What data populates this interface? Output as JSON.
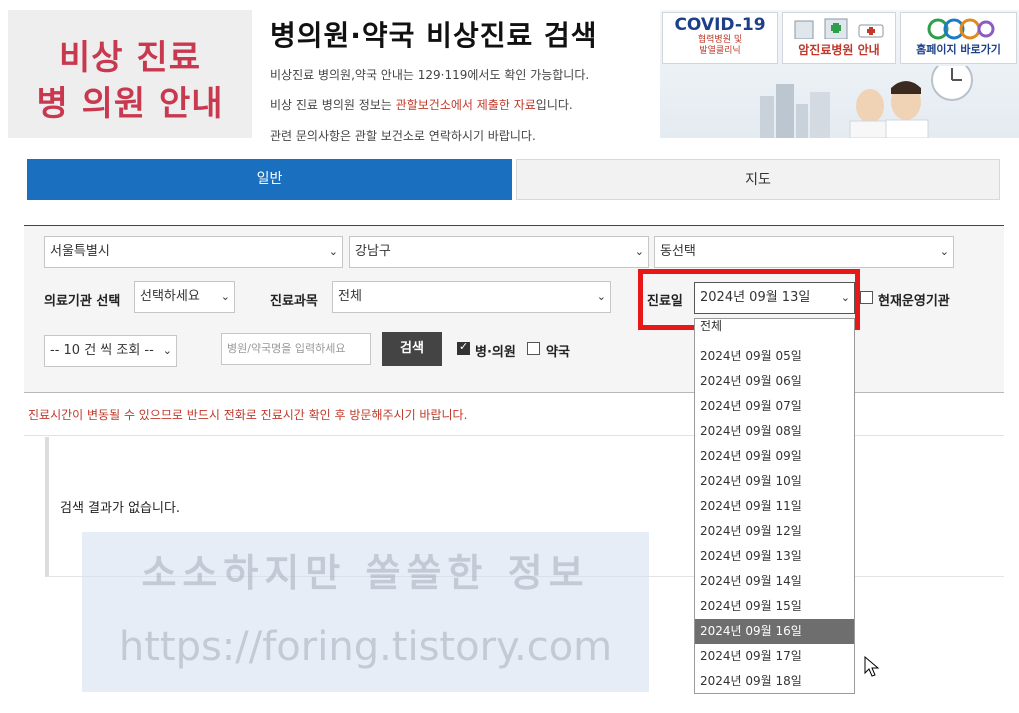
{
  "logo": {
    "line1": "비상 진료",
    "line2": "병 의원 안내"
  },
  "title": "병의원·약국 비상진료 검색",
  "info": {
    "line1": "비상진료 병의원,약국 안내는 129·119에서도 확인 가능합니다.",
    "line2_prefix": "비상 진료 병의원 정보는 ",
    "line2_highlight": "관할보건소에서 제출한 자료",
    "line2_suffix": "입니다.",
    "line3": "관련 문의사항은 관할 보건소로 연락하시기 바랍니다."
  },
  "banners": {
    "covid_title": "COVID-19",
    "covid_sub1": "협력병원 및",
    "covid_sub2": "발열클리닉",
    "cancer": "암진료병원 안내",
    "homepage": "홈페이지 바로가기"
  },
  "tabs": [
    {
      "label": "일반",
      "active": true
    },
    {
      "label": "지도",
      "active": false
    }
  ],
  "filters": {
    "city": "서울특별시",
    "district": "강남구",
    "dong": "동선택",
    "institution_label": "의료기관 선택",
    "institution_value": "선택하세요",
    "department_label": "진료과목",
    "department_value": "전체",
    "date_label": "진료일",
    "date_value": "2024년 09월 13일",
    "open_now_label": "현재운영기관",
    "page_size": "-- 10 건 씩 조회 --",
    "search_placeholder": "병원/약국명을 입력하세요",
    "search_button": "검색",
    "hospital_label": "병·의원",
    "hospital_checked": true,
    "pharmacy_label": "약국",
    "pharmacy_checked": false
  },
  "date_options": [
    {
      "label": "전체",
      "selected": false
    },
    {
      "label": "2024년 09월 05일",
      "selected": false
    },
    {
      "label": "2024년 09월 06일",
      "selected": false
    },
    {
      "label": "2024년 09월 07일",
      "selected": false
    },
    {
      "label": "2024년 09월 08일",
      "selected": false
    },
    {
      "label": "2024년 09월 09일",
      "selected": false
    },
    {
      "label": "2024년 09월 10일",
      "selected": false
    },
    {
      "label": "2024년 09월 11일",
      "selected": false
    },
    {
      "label": "2024년 09월 12일",
      "selected": false
    },
    {
      "label": "2024년 09월 13일",
      "selected": false
    },
    {
      "label": "2024년 09월 14일",
      "selected": false
    },
    {
      "label": "2024년 09월 15일",
      "selected": false
    },
    {
      "label": "2024년 09월 16일",
      "selected": true
    },
    {
      "label": "2024년 09월 17일",
      "selected": false
    },
    {
      "label": "2024년 09월 18일",
      "selected": false
    }
  ],
  "notice": "진료시간이 변동될 수 있으므로 반드시 전화로 진료시간 확인 후 방문해주시기 바랍니다.",
  "no_result": "검색 결과가 없습니다.",
  "watermark": {
    "line1": "소소하지만 쏠쏠한 정보",
    "line2": "https://foring.tistory.com"
  },
  "colors": {
    "primary": "#1a70bf",
    "alert_red": "#e81818",
    "logo_pink": "#c8394f"
  }
}
